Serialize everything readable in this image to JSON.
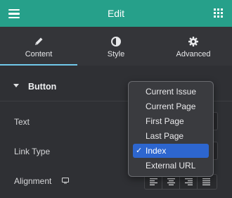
{
  "header": {
    "title": "Edit",
    "menu_icon": "hamburger-icon",
    "apps_icon": "grid-icon",
    "color": "#26a08a"
  },
  "tabs": [
    {
      "label": "Content",
      "icon": "pencil-icon",
      "active": true
    },
    {
      "label": "Style",
      "icon": "half-circle-icon",
      "active": false
    },
    {
      "label": "Advanced",
      "icon": "gear-icon",
      "active": false
    }
  ],
  "section": {
    "title": "Button",
    "expanded": true
  },
  "controls": {
    "text_label": "Text",
    "link_type_label": "Link Type",
    "alignment_label": "Alignment",
    "responsive_icon": "monitor-icon",
    "alignment_options": [
      "align-left",
      "align-center",
      "align-right",
      "align-justify"
    ]
  },
  "dropdown": {
    "options": [
      "Current Issue",
      "Current Page",
      "First Page",
      "Last Page",
      "Index",
      "External URL"
    ],
    "selected": "Index",
    "check_mark": "✓",
    "selected_color": "#2d66cf"
  }
}
